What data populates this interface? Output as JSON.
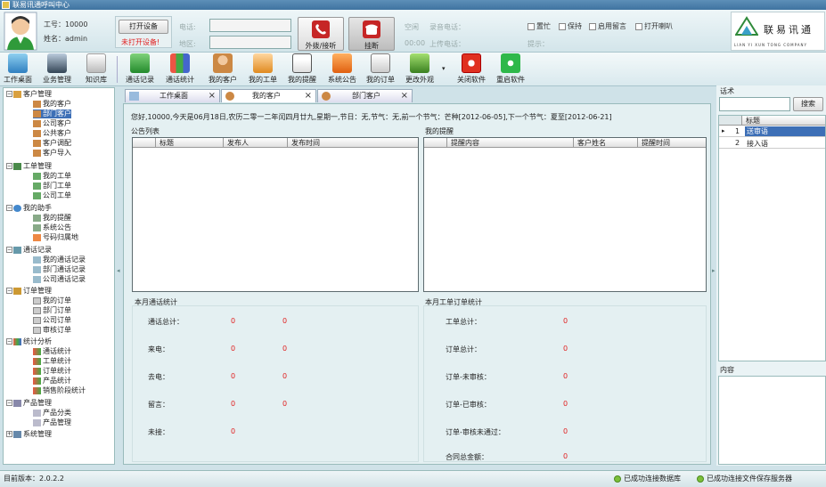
{
  "window": {
    "title": "联易讯通呼叫中心"
  },
  "user": {
    "id_label": "工号：10000",
    "name_label": "姓名：admin"
  },
  "device": {
    "open_button": "打开设备",
    "status": "未打开设备!"
  },
  "phone": {
    "phone_label": "电话:",
    "area_label": "地区:",
    "dial_label": "外拨/接听",
    "hangup_label": "挂断"
  },
  "line": {
    "state": "空闲",
    "time": "00:00",
    "recorded_label": "录音电话：",
    "upload_label": "上传电话：",
    "hint_label": "提示："
  },
  "options": {
    "busy": "置忙",
    "hold": "保持",
    "voicemail": "启用留言",
    "speaker": "打开喇叭"
  },
  "logo": {
    "text": "联易讯通",
    "sub": "LIAN YI XUN TONG COMPANY"
  },
  "toolbar": [
    "工作桌面",
    "业务管理",
    "知识库",
    "通话记录",
    "通话统计",
    "我的客户",
    "我的工单",
    "我的提醒",
    "系统公告",
    "我的订单",
    "更改外观",
    "关闭软件",
    "重启软件"
  ],
  "tree": {
    "customer": {
      "label": "客户管理",
      "items": [
        "我的客户",
        "部门客户",
        "公司客户",
        "公共客户",
        "客户调配",
        "客户导入"
      ]
    },
    "ticket": {
      "label": "工单管理",
      "items": [
        "我的工单",
        "部门工单",
        "公司工单"
      ]
    },
    "helper": {
      "label": "我的助手",
      "items": [
        "我的提醒",
        "系统公告",
        "号码归属地"
      ]
    },
    "calls": {
      "label": "通话记录",
      "items": [
        "我的通话记录",
        "部门通话记录",
        "公司通话记录"
      ]
    },
    "orders": {
      "label": "订单管理",
      "items": [
        "我的订单",
        "部门订单",
        "公司订单",
        "审核订单"
      ]
    },
    "stats": {
      "label": "统计分析",
      "items": [
        "通话统计",
        "工单统计",
        "订单统计",
        "产品统计",
        "销售阶段统计"
      ]
    },
    "product": {
      "label": "产品管理",
      "items": [
        "产品分类",
        "产品管理"
      ]
    },
    "system": {
      "label": "系统管理"
    }
  },
  "tabs": [
    "工作桌面",
    "我的客户",
    "部门客户"
  ],
  "greeting": "您好,10000,今天是06月18日,农历二零一二年闰四月廿九,星期一,节日：无,节气：无,前一个节气：芒种[2012-06-05],下一个节气：夏至[2012-06-21]",
  "notice": {
    "title": "公告列表",
    "cols": [
      "标题",
      "发布人",
      "发布时间"
    ]
  },
  "reminder": {
    "title": "我的提醒",
    "cols": [
      "提醒内容",
      "客户姓名",
      "提醒时间"
    ]
  },
  "call_stats": {
    "title": "本月通话统计",
    "rows": [
      {
        "label": "通话总计：",
        "a": "0",
        "b": "0"
      },
      {
        "label": "来电：",
        "a": "0",
        "b": "0"
      },
      {
        "label": "去电：",
        "a": "0",
        "b": "0"
      },
      {
        "label": "留言：",
        "a": "0",
        "b": "0"
      },
      {
        "label": "未接：",
        "a": "0"
      }
    ]
  },
  "order_stats": {
    "title": "本月工单订单统计",
    "rows": [
      {
        "label": "工单总计：",
        "v": "0"
      },
      {
        "label": "订单总计：",
        "v": "0"
      },
      {
        "label": "订单-未审核：",
        "v": "0"
      },
      {
        "label": "订单-已审核：",
        "v": "0"
      },
      {
        "label": "订单-审核未通过：",
        "v": "0"
      },
      {
        "label": "合同总金额：",
        "v": "0"
      }
    ]
  },
  "script": {
    "title": "话术",
    "search": "搜索",
    "col": "标题",
    "rows": [
      {
        "n": "1",
        "t": "送审语"
      },
      {
        "n": "2",
        "t": "接入语"
      }
    ],
    "content_label": "内容"
  },
  "status": {
    "version": "目前版本：2.0.2.2",
    "db": "已成功连接数据库",
    "file": "已成功连接文件保存服务器"
  }
}
